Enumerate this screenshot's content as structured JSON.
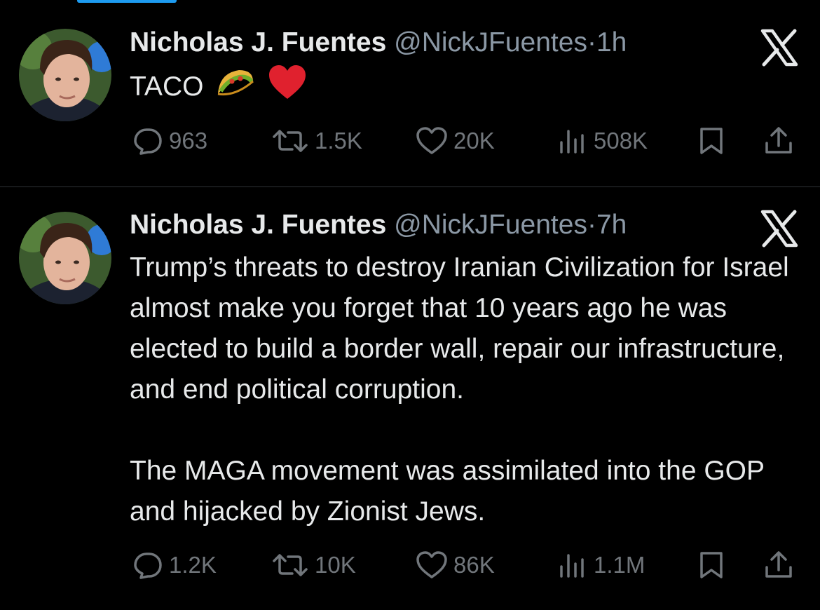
{
  "tweets": [
    {
      "author_name": "Nicholas J. Fuentes",
      "handle": "@NickJFuentes",
      "separator": "·",
      "time": "1h",
      "text_paragraphs": [
        "TACO"
      ],
      "emojis": [
        "taco",
        "red-heart"
      ],
      "stats": {
        "replies": "963",
        "reposts": "1.5K",
        "likes": "20K",
        "views": "508K"
      }
    },
    {
      "author_name": "Nicholas J. Fuentes",
      "handle": "@NickJFuentes",
      "separator": "·",
      "time": "7h",
      "text_paragraphs": [
        "Trump’s threats to destroy Iranian Civilization for Israel almost make you forget that 10 years ago he was elected to build a border wall, repair our infrastructure, and end political corruption.",
        "The MAGA movement was assimilated into the GOP and hijacked by Zionist Jews."
      ],
      "stats": {
        "replies": "1.2K",
        "reposts": "10K",
        "likes": "86K",
        "views": "1.1M"
      }
    }
  ],
  "icons": [
    "x-logo-icon",
    "reply-icon",
    "repost-icon",
    "like-icon",
    "views-icon",
    "bookmark-icon",
    "share-icon"
  ],
  "colors": {
    "background": "#000000",
    "text": "#e7e9ea",
    "secondary": "#8b98a5",
    "icon": "#71767b",
    "accent": "#1d9bf0"
  }
}
